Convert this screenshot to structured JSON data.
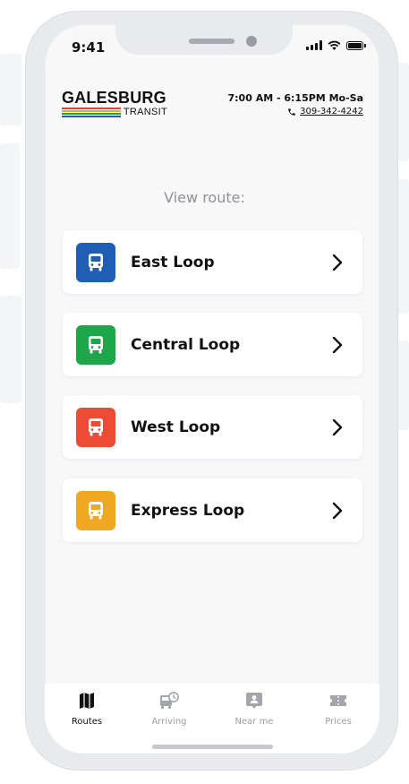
{
  "status_bar": {
    "time": "9:41"
  },
  "header": {
    "logo_main": "GALESBURG",
    "logo_sub": "TRANSIT",
    "logo_stripe_colors": [
      "#e8433a",
      "#f3a81f",
      "#18a84a",
      "#1f5eb3"
    ],
    "hours": "7:00 AM - 6:15PM Mo-Sa",
    "phone": "309-342-4242"
  },
  "prompt": "View route:",
  "routes": [
    {
      "label": "East Loop",
      "color": "#1e5eb5",
      "icon": "bus-icon"
    },
    {
      "label": "Central Loop",
      "color": "#1ea64a",
      "icon": "bus-icon"
    },
    {
      "label": "West Loop",
      "color": "#ee4b35",
      "icon": "bus-icon"
    },
    {
      "label": "Express Loop",
      "color": "#f0a823",
      "icon": "bus-icon"
    }
  ],
  "tabs": [
    {
      "label": "Routes",
      "icon": "map-icon",
      "active": true
    },
    {
      "label": "Arriving",
      "icon": "bus-clock-icon",
      "active": false
    },
    {
      "label": "Near me",
      "icon": "location-pin-icon",
      "active": false
    },
    {
      "label": "Prices",
      "icon": "ticket-icon",
      "active": false
    }
  ]
}
